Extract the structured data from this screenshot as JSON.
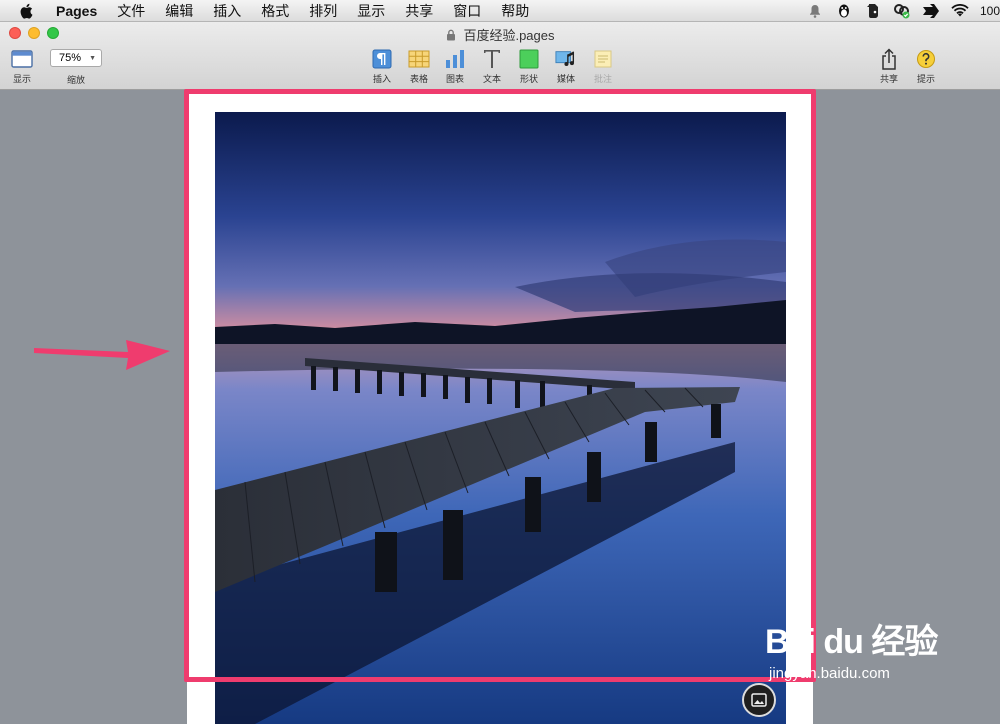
{
  "menubar": {
    "app_name": "Pages",
    "items": [
      "文件",
      "编辑",
      "插入",
      "格式",
      "排列",
      "显示",
      "共享",
      "窗口",
      "帮助"
    ],
    "battery_text": "100"
  },
  "window": {
    "title": "百度经验.pages"
  },
  "toolbar": {
    "view_label": "显示",
    "zoom_value": "75%",
    "zoom_label": "缩放",
    "tools": [
      {
        "label": "插入",
        "icon": "insert-icon"
      },
      {
        "label": "表格",
        "icon": "table-icon"
      },
      {
        "label": "图表",
        "icon": "chart-icon"
      },
      {
        "label": "文本",
        "icon": "text-icon"
      },
      {
        "label": "形状",
        "icon": "shape-icon"
      },
      {
        "label": "媒体",
        "icon": "media-icon"
      },
      {
        "label": "批注",
        "icon": "comment-icon"
      }
    ],
    "share_label": "共享",
    "tips_label": "提示"
  },
  "watermark": {
    "logo": "Bai du 经验",
    "url": "jingyan.baidu.com"
  },
  "colors": {
    "highlight": "#ef3c6e",
    "canvas": "#8e939a"
  }
}
